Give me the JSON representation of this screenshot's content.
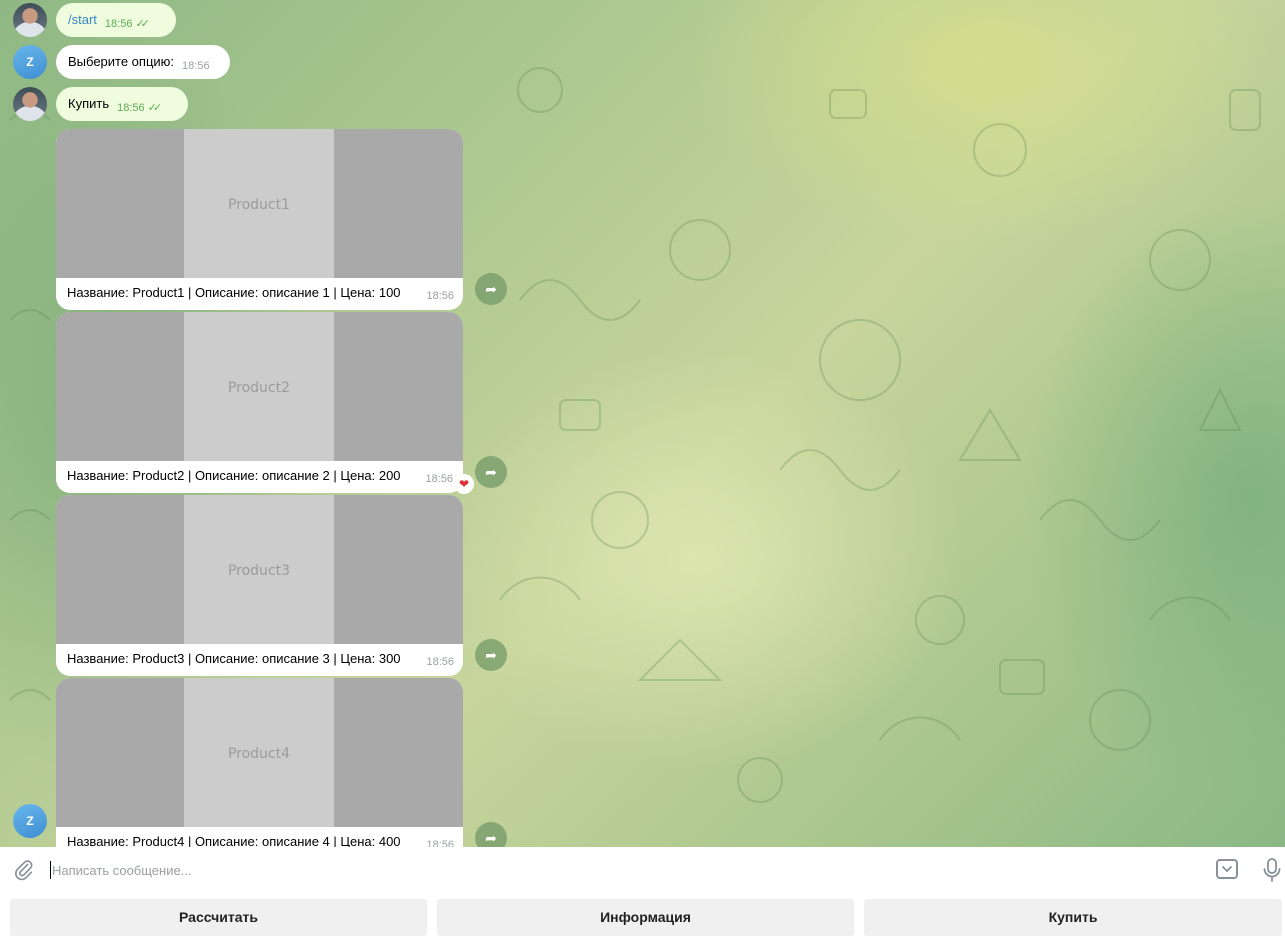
{
  "chat": {
    "messages": [
      {
        "text": "/start",
        "time": "18:56",
        "ticks": "✓✓"
      },
      {
        "text": "Выберите опцию:",
        "time": "18:56"
      },
      {
        "text": "Купить",
        "time": "18:56",
        "ticks": "✓✓"
      }
    ],
    "bot_avatar_letter": "Z",
    "products": [
      {
        "image_label": "Product1",
        "caption": "Название: Product1 | Описание: описание 1 | Цена: 100",
        "time": "18:56"
      },
      {
        "image_label": "Product2",
        "caption": "Название: Product2 | Описание: описание 2 | Цена: 200",
        "time": "18:56",
        "reaction": "❤"
      },
      {
        "image_label": "Product3",
        "caption": "Название: Product3 | Описание: описание 3 | Цена: 300",
        "time": "18:56"
      },
      {
        "image_label": "Product4",
        "caption": "Название: Product4 | Описание: описание 4 | Цена: 400",
        "time": "18:56"
      }
    ]
  },
  "composer": {
    "placeholder": "Написать сообщение...",
    "keyboard_buttons": [
      "Рассчитать",
      "Информация",
      "Купить"
    ]
  },
  "colors": {
    "outgoing_bubble": "#effdde",
    "incoming_bubble": "#ffffff",
    "check_green": "#5ea957",
    "command_link": "#3a88c8"
  },
  "icons": [
    "paperclip-icon",
    "keyboard-toggle-icon",
    "microphone-icon",
    "forward-icon",
    "heart-reaction-icon"
  ]
}
